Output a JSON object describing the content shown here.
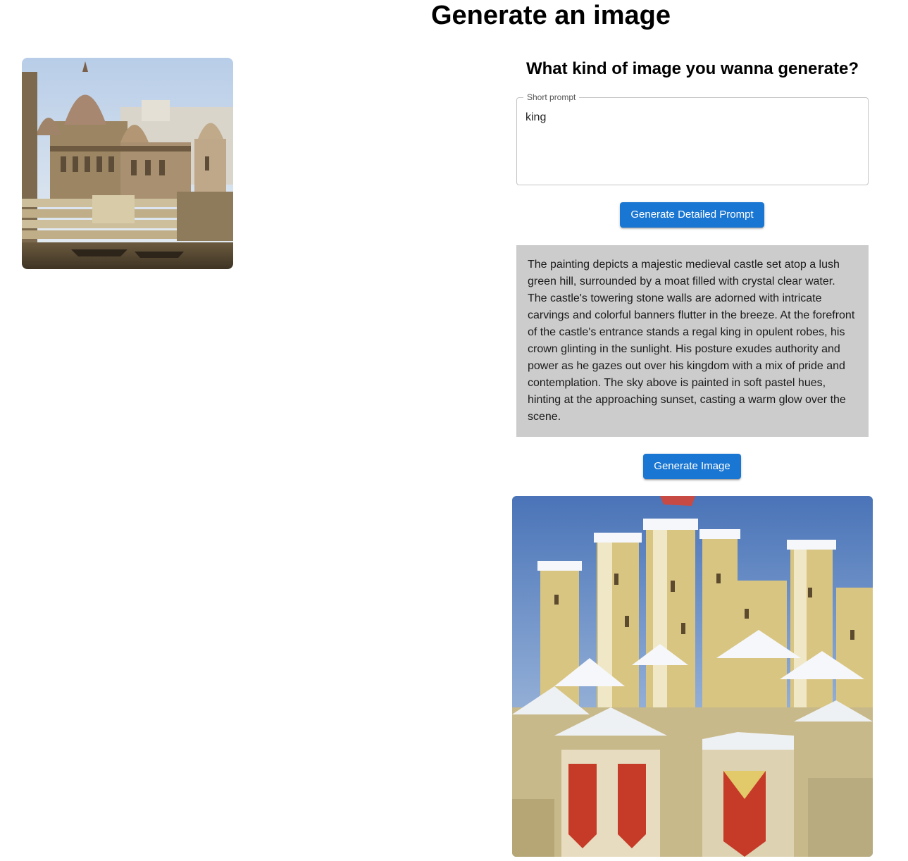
{
  "page": {
    "title": "Generate an image"
  },
  "thumbnail": {
    "icon": "varanasi-ghats-painting-image"
  },
  "form": {
    "heading": "What kind of image you wanna generate?",
    "short_prompt_label": "Short prompt",
    "short_prompt_value": "king",
    "generate_prompt_button": "Generate Detailed Prompt",
    "detailed_prompt": "The painting depicts a majestic medieval castle set atop a lush green hill, surrounded by a moat filled with crystal clear water. The castle's towering stone walls are adorned with intricate carvings and colorful banners flutter in the breeze. At the forefront of the castle's entrance stands a regal king in opulent robes, his crown glinting in the sunlight. His posture exudes authority and power as he gazes out over his kingdom with a mix of pride and contemplation. The sky above is painted in soft pastel hues, hinting at the approaching sunset, casting a warm glow over the scene.",
    "generate_image_button": "Generate Image"
  },
  "result": {
    "icon": "snowy-castle-painting-image"
  },
  "colors": {
    "button": "#1976d2",
    "detailed_bg": "#cccccc"
  }
}
